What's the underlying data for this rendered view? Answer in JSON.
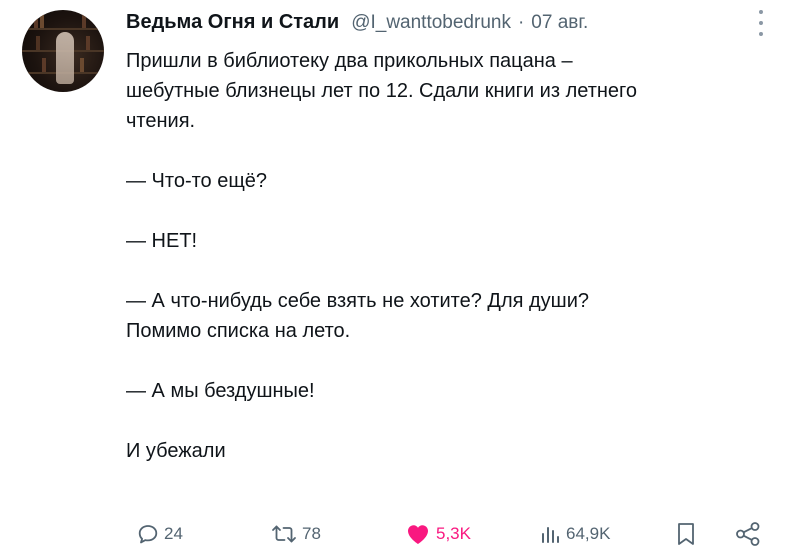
{
  "tweet": {
    "author_name": "Ведьма Огня и Стали",
    "handle": "@I_wanttobedrunk",
    "separator": "·",
    "date": "07 авг.",
    "lines": [
      "Пришли в библиотеку два прикольных пацана –",
      "шебутные близнецы лет по 12. Сдали книги из летнего",
      "чтения.",
      "",
      "— Что-то ещё?",
      "",
      "— НЕТ!",
      "",
      "— А что-нибудь себе взять не хотите? Для души?",
      "Помимо списка на лето.",
      "",
      "— А мы бездушные!",
      "",
      "И убежали"
    ]
  },
  "actions": {
    "replies": "24",
    "retweets": "78",
    "likes": "5,3K",
    "views": "64,9K"
  },
  "icons": {
    "reply": "reply-icon",
    "retweet": "retweet-icon",
    "like": "heart-icon",
    "views": "views-icon",
    "bookmark": "bookmark-icon",
    "share": "share-icon",
    "more": "more-icon"
  },
  "colors": {
    "text": "#0f1419",
    "secondary": "#536471",
    "like": "#f91880"
  }
}
